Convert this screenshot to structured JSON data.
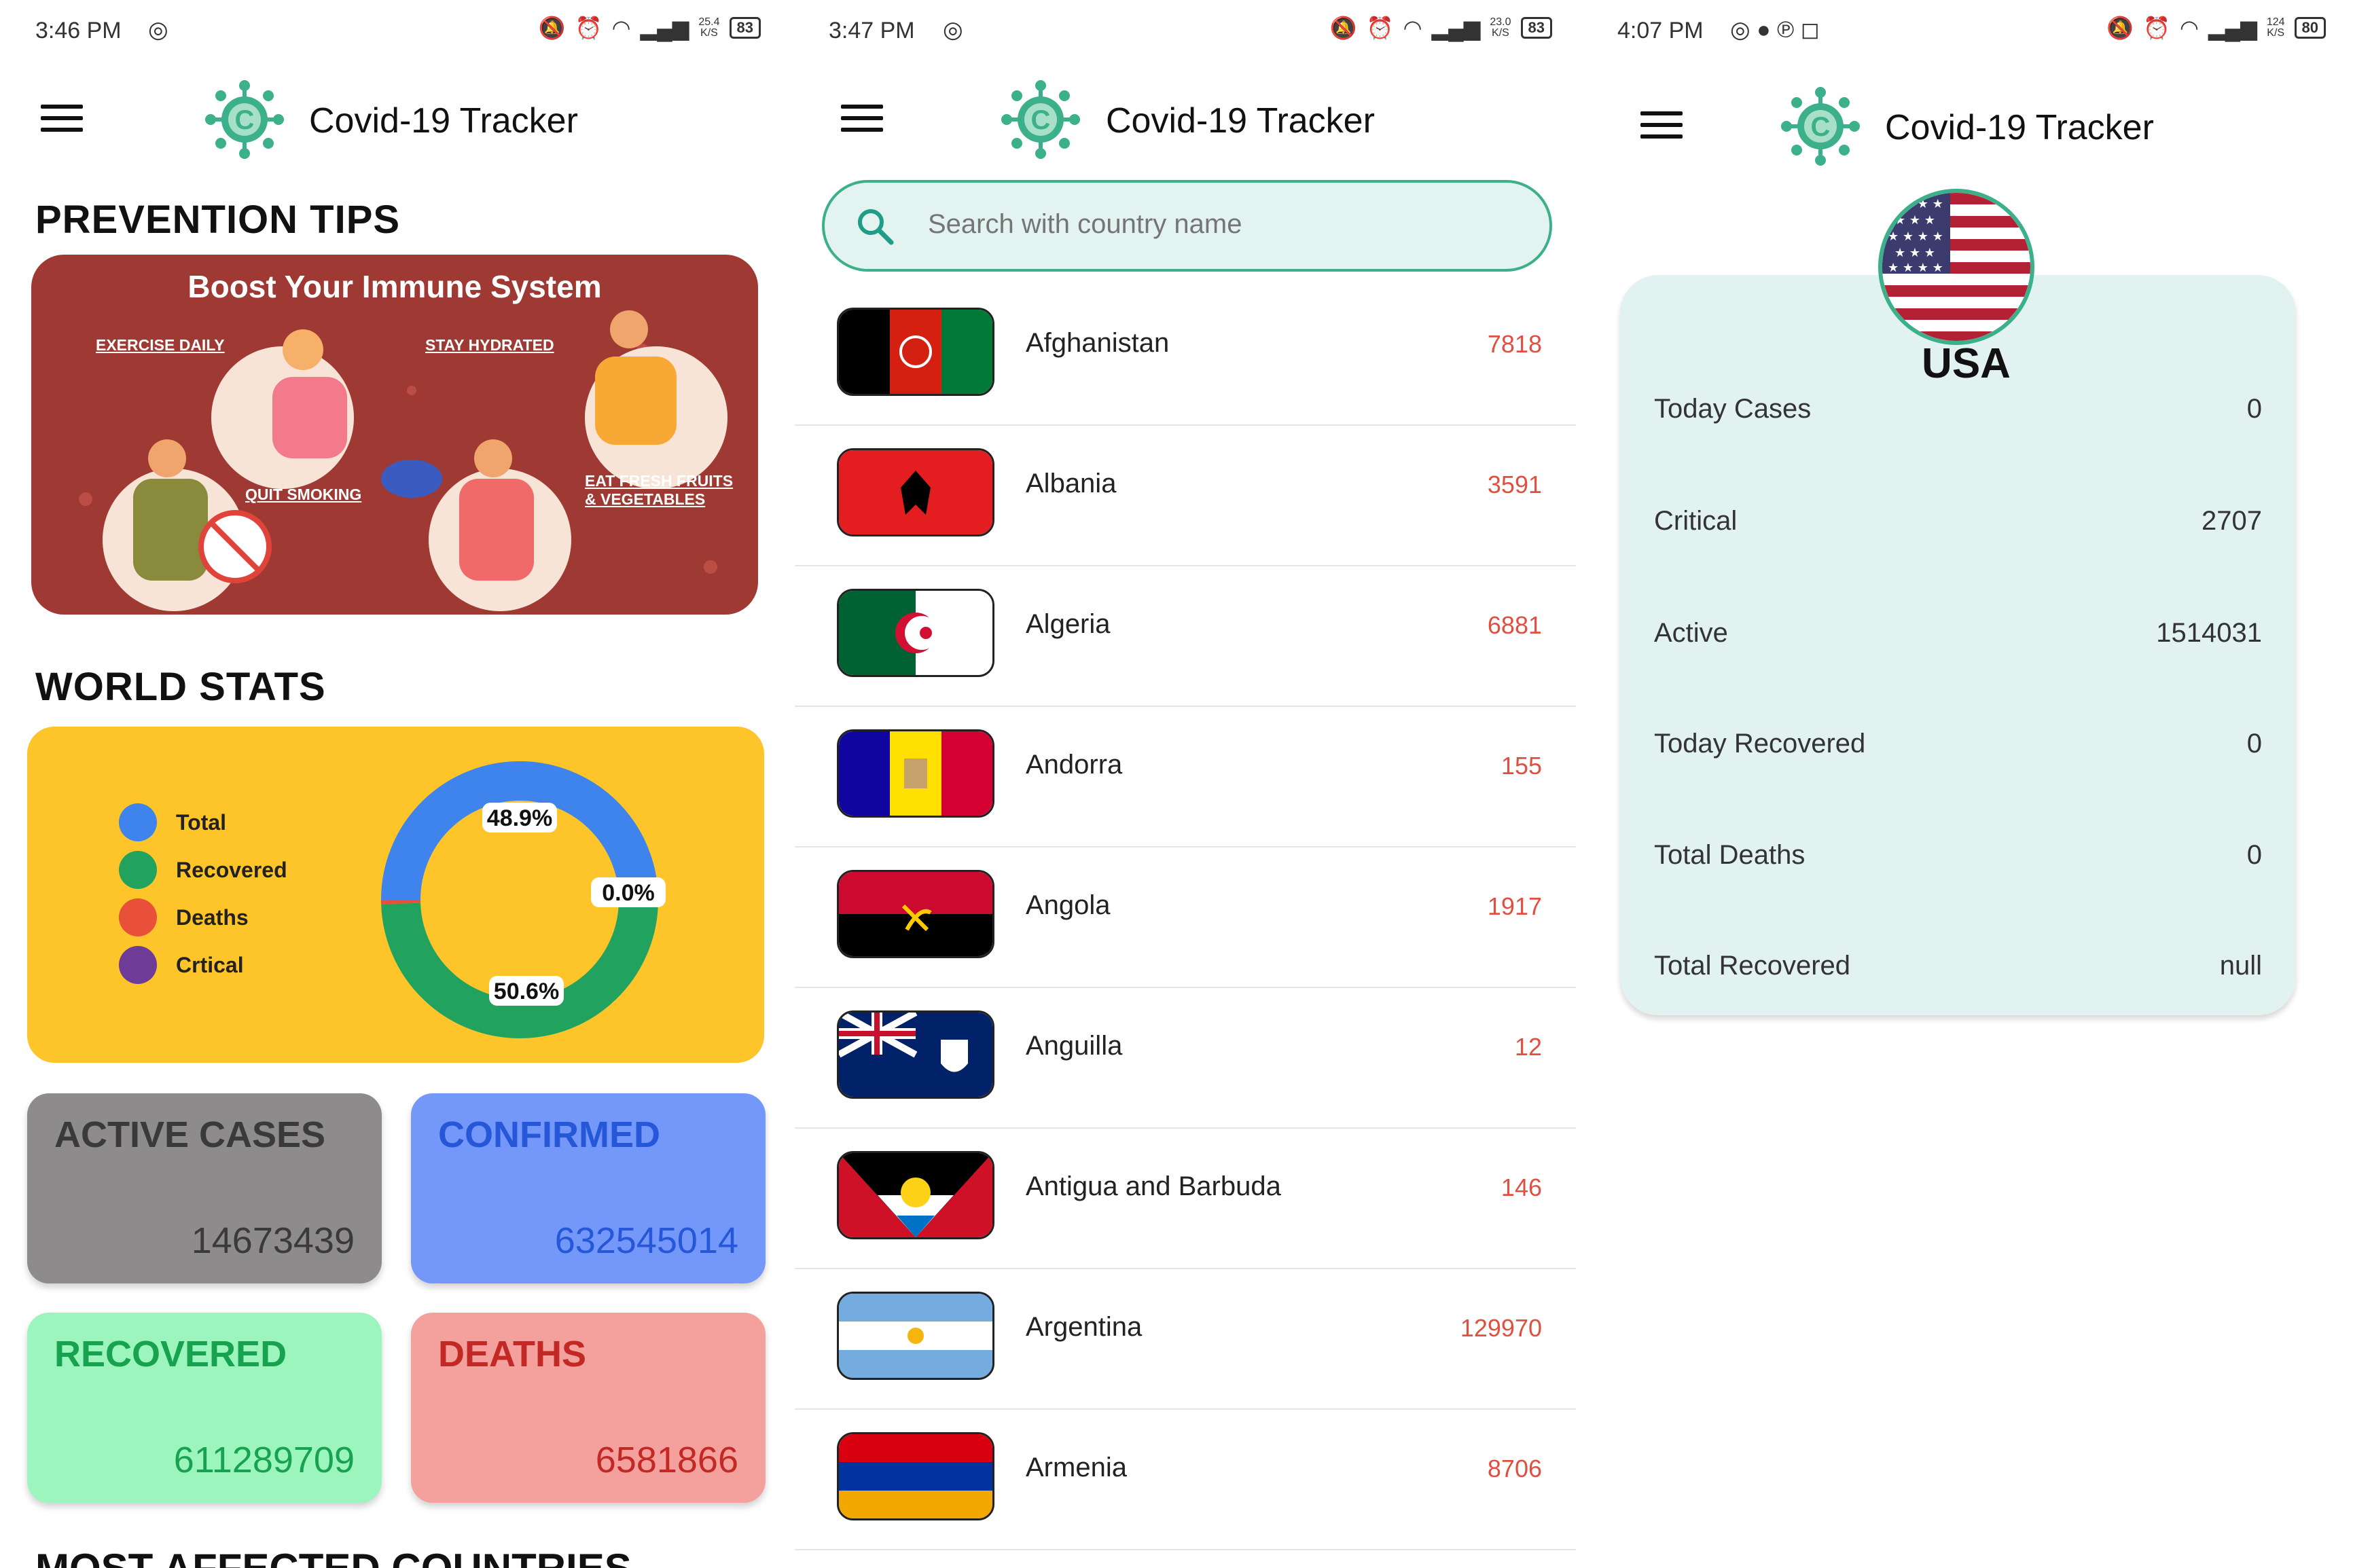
{
  "app": {
    "title": "Covid-19 Tracker"
  },
  "screens": [
    {
      "status": {
        "time": "3:46 PM",
        "speed": "25.4\nK/S",
        "battery": "83"
      }
    },
    {
      "status": {
        "time": "3:47 PM",
        "speed": "23.0\nK/S",
        "battery": "83"
      }
    },
    {
      "status": {
        "time": "4:07 PM",
        "speed": "124\nK/S",
        "battery": "80"
      }
    }
  ],
  "home": {
    "prevention_title": "PREVENTION TIPS",
    "tips_card": {
      "heading": "Boost Your Immune System",
      "tips": [
        "EXERCISE DAILY",
        "STAY HYDRATED",
        "QUIT SMOKING",
        "EAT FRESH FRUITS\n& VEGETABLES"
      ]
    },
    "world_stats_title": "WORLD STATS",
    "legend": [
      {
        "label": "Total",
        "color": "#3f83ec"
      },
      {
        "label": "Recovered",
        "color": "#21a35f"
      },
      {
        "label": "Deaths",
        "color": "#e8503a"
      },
      {
        "label": "Crtical",
        "color": "#6e3c96"
      }
    ],
    "chart_data": {
      "type": "pie",
      "categories": [
        "Total",
        "Recovered",
        "Deaths",
        "Crtical"
      ],
      "values": [
        50.6,
        48.9,
        0.5,
        0.0
      ],
      "labels": [
        "50.6%",
        "48.9%",
        "0.0%"
      ],
      "colors": [
        "#3f83ec",
        "#21a35f",
        "#e8503a",
        "#6e3c96"
      ]
    },
    "tiles": {
      "active": {
        "label": "ACTIVE CASES",
        "value": "14673439",
        "bg": "#8d8b8c",
        "fg": "#3a3a3a"
      },
      "confirmed": {
        "label": "CONFIRMED",
        "value": "632545014",
        "bg": "#7398fa",
        "fg": "#2557d8"
      },
      "recovered": {
        "label": "RECOVERED",
        "value": "611289709",
        "bg": "#9bf5bc",
        "fg": "#17a24f"
      },
      "deaths": {
        "label": "DEATHS",
        "value": "6581866",
        "bg": "#f4a09c",
        "fg": "#c22824"
      }
    },
    "most_affected_title": "MOST AFFECTED COUNTRIES"
  },
  "countries": {
    "search_placeholder": "Search with country name",
    "items": [
      {
        "name": "Afghanistan",
        "count": "7818"
      },
      {
        "name": "Albania",
        "count": "3591"
      },
      {
        "name": "Algeria",
        "count": "6881"
      },
      {
        "name": "Andorra",
        "count": "155"
      },
      {
        "name": "Angola",
        "count": "1917"
      },
      {
        "name": "Anguilla",
        "count": "12"
      },
      {
        "name": "Antigua and Barbuda",
        "count": "146"
      },
      {
        "name": "Argentina",
        "count": "129970"
      },
      {
        "name": "Armenia",
        "count": "8706"
      }
    ]
  },
  "detail": {
    "country": "USA",
    "stats": [
      {
        "label": "Today Cases",
        "value": "0"
      },
      {
        "label": "Critical",
        "value": "2707"
      },
      {
        "label": "Active",
        "value": "1514031"
      },
      {
        "label": "Today Recovered",
        "value": "0"
      },
      {
        "label": "Total Deaths",
        "value": "0"
      },
      {
        "label": "Total Recovered",
        "value": "null"
      }
    ]
  }
}
